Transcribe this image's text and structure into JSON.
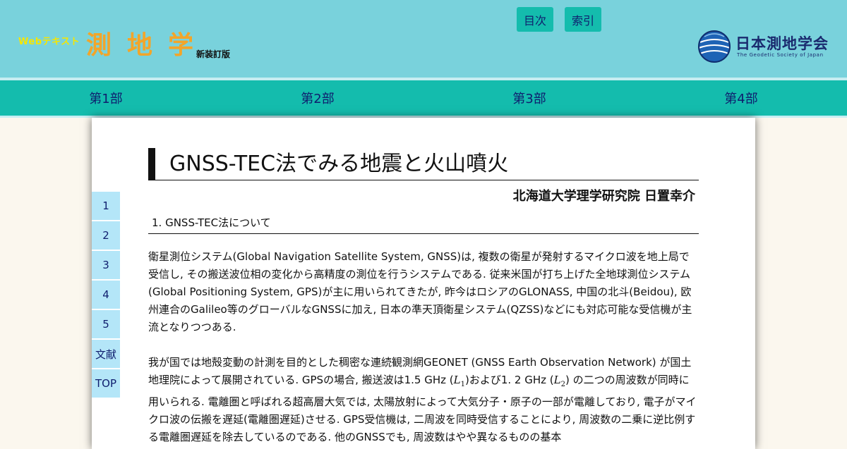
{
  "header": {
    "logo_prefix": "Webテキスト",
    "logo_main": "測地学",
    "logo_edition": "新装訂版",
    "buttons": [
      "目次",
      "索引"
    ],
    "society_name": "日本測地学会",
    "society_en": "The Geodetic Society of Japan"
  },
  "nav": [
    "第1部",
    "第2部",
    "第3部",
    "第4部"
  ],
  "side": [
    "1",
    "2",
    "3",
    "4",
    "5",
    "文献",
    "TOP"
  ],
  "article": {
    "title": "GNSS-TEC法でみる地震と火山噴火",
    "author": "北海道大学理学研究院 日置幸介",
    "section": "1. GNSS-TEC法について",
    "para1": "衛星測位システム(Global Navigation Satellite System, GNSS)は, 複数の衛星が発射するマイクロ波を地上局で受信し, その搬送波位相の変化から高精度の測位を行うシステムである. 従来米国が打ち上げた全地球測位システム(Global Positioning System, GPS)が主に用いられてきたが, 昨今はロシアのGLONASS, 中国の北斗(Beidou), 欧州連合のGalileo等のグローバルなGNSSに加え, 日本の準天頂衛星システム(QZSS)などにも対応可能な受信機が主流となりつつある.",
    "para2_a": "我が国では地殻変動の計測を目的とした稠密な連続観測網GEONET (GNSS Earth Observation Network) が国土地理院によって展開されている. GPSの場合, 搬送波は1.5 GHz (",
    "L": "L",
    "sub1": "1",
    "para2_b": ")および1. 2 GHz (",
    "sub2": "2",
    "para2_c": ") の二つの周波数が同時に用いられる. 電離圏と呼ばれる超高層大気では, 太陽放射によって大気分子・原子の一部が電離しており, 電子がマイクロ波の伝搬を遅延(電離圏遅延)させる. GPS受信機は, 二周波を同時受信することにより, 周波数の二乗に逆比例する電離圏遅延を除去しているのである. 他のGNSSでも, 周波数はやや異なるものの基本"
  },
  "colors": {
    "header_bg": "#79d2dc",
    "nav_bg": "#14bcad",
    "nav_text": "#0f1e6e",
    "side_bg": "#b4e6f8",
    "logo_orange": "#f2a52a",
    "logo_yellow": "#f6e600"
  }
}
